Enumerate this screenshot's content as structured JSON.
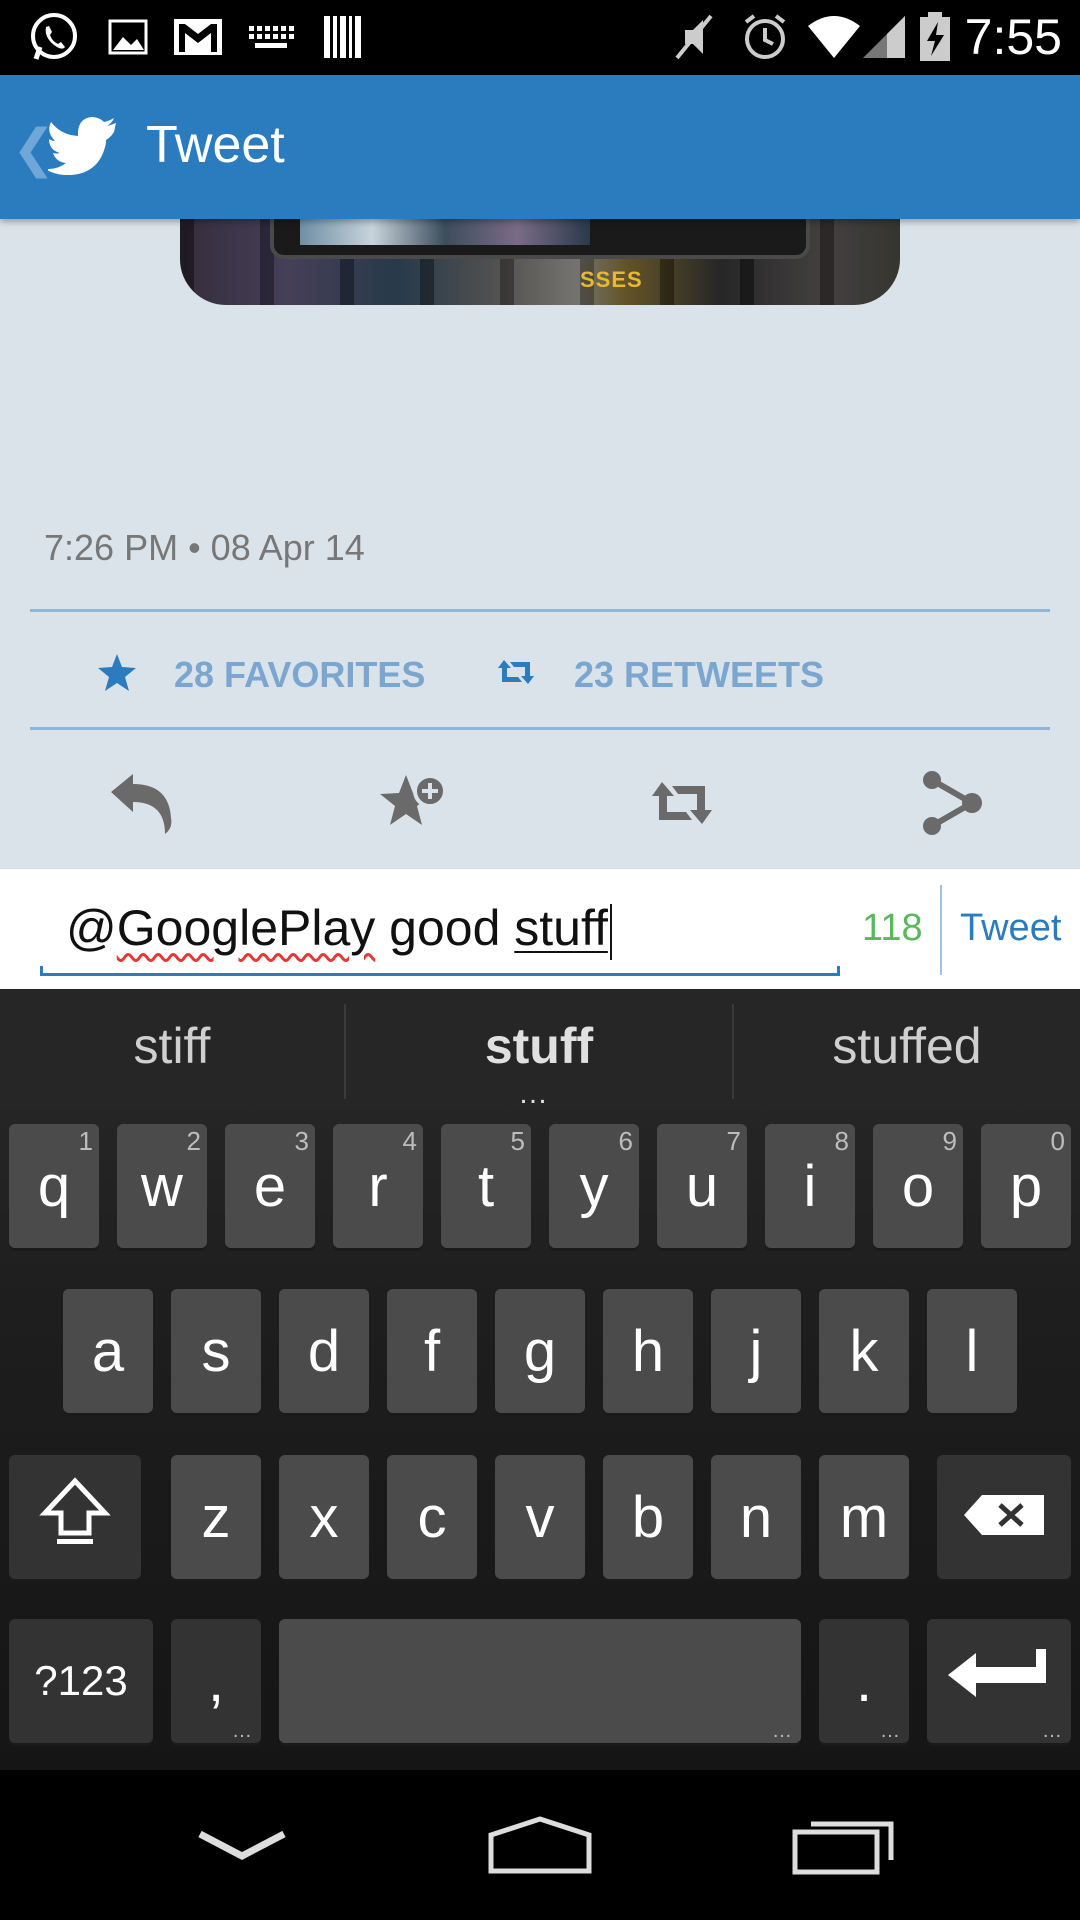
{
  "status_bar": {
    "time": "7:55",
    "left_icons": [
      "whatsapp-icon",
      "gallery-icon",
      "gmail-icon",
      "keyboard-icon",
      "barcode-icon"
    ],
    "right_icons": [
      "mute-icon",
      "alarm-icon",
      "wifi-icon",
      "signal-icon",
      "battery-charging-icon"
    ]
  },
  "action_bar": {
    "back_glyph": "❮",
    "title": "Tweet",
    "color": "#2b7bbf"
  },
  "tweet": {
    "media_text": "SSES",
    "timestamp": "7:26 PM • 08 Apr 14",
    "favorites_label": "28 FAVORITES",
    "retweets_label": "23 RETWEETS",
    "actions": [
      "reply",
      "favorite",
      "retweet",
      "share"
    ]
  },
  "compose": {
    "text_prefix": "@",
    "mention": "GooglePlay",
    "text_middle": " good ",
    "composing_word": "stuff",
    "char_count": "118",
    "tweet_button": "Tweet",
    "count_color": "#5cb85c"
  },
  "keyboard": {
    "suggestions": [
      "stiff",
      "stuff",
      "stuffed"
    ],
    "row1": [
      {
        "k": "q",
        "h": "1"
      },
      {
        "k": "w",
        "h": "2"
      },
      {
        "k": "e",
        "h": "3"
      },
      {
        "k": "r",
        "h": "4"
      },
      {
        "k": "t",
        "h": "5"
      },
      {
        "k": "y",
        "h": "6"
      },
      {
        "k": "u",
        "h": "7"
      },
      {
        "k": "i",
        "h": "8"
      },
      {
        "k": "o",
        "h": "9"
      },
      {
        "k": "p",
        "h": "0"
      }
    ],
    "row2": [
      "a",
      "s",
      "d",
      "f",
      "g",
      "h",
      "j",
      "k",
      "l"
    ],
    "row3": [
      "z",
      "x",
      "c",
      "v",
      "b",
      "n",
      "m"
    ],
    "symbols_key": "?123",
    "comma_key": ",",
    "period_key": ".",
    "more_dots": "…"
  },
  "nav_bar": {
    "buttons": [
      "hide-keyboard",
      "home",
      "recents"
    ]
  }
}
